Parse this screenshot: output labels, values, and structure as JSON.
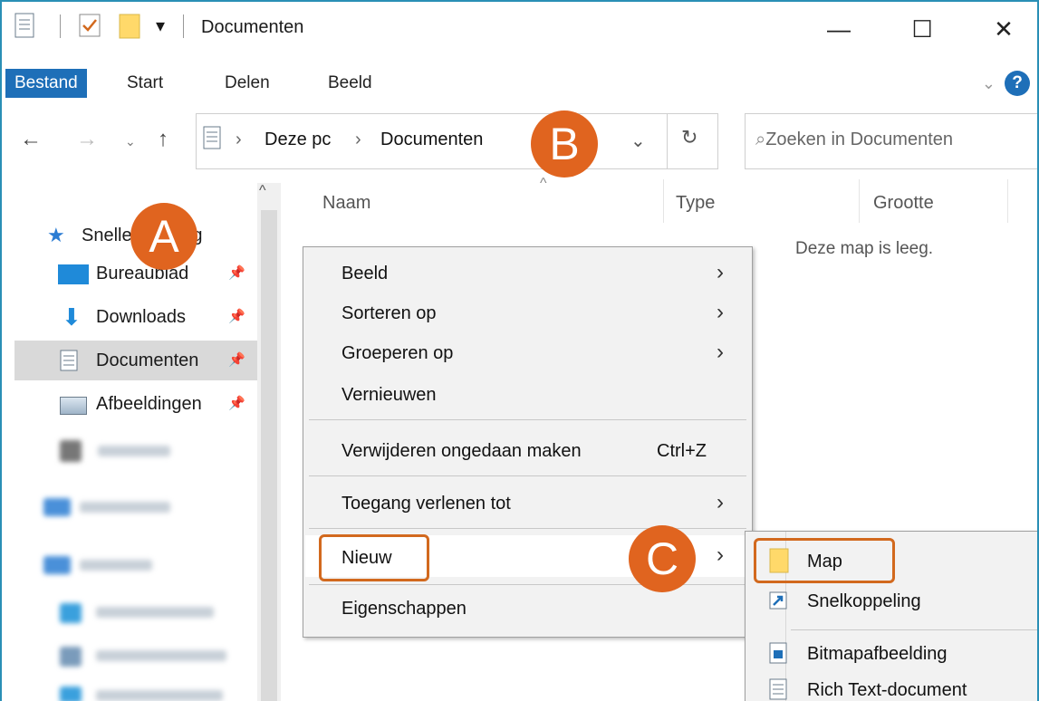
{
  "window": {
    "title": "Documenten"
  },
  "ribbon": {
    "tabs": [
      "Bestand",
      "Start",
      "Delen",
      "Beeld"
    ]
  },
  "address": {
    "crumb_root": "Deze pc",
    "crumb_current": "Documenten"
  },
  "search": {
    "placeholder": "Zoeken in Documenten"
  },
  "nav": {
    "quick_access": "Snelle toegang",
    "items": [
      "Bureaublad",
      "Downloads",
      "Documenten",
      "Afbeeldingen"
    ]
  },
  "columns": {
    "name": "Naam",
    "type": "Type",
    "size": "Grootte"
  },
  "content": {
    "empty": "Deze map is leeg."
  },
  "context_menu": {
    "items": [
      "Beeld",
      "Sorteren op",
      "Groeperen op",
      "Vernieuwen",
      "Verwijderen ongedaan maken",
      "Toegang verlenen tot",
      "Nieuw",
      "Eigenschappen"
    ],
    "undo_shortcut": "Ctrl+Z"
  },
  "submenu": {
    "items": [
      "Map",
      "Snelkoppeling",
      "Bitmapafbeelding",
      "Rich Text-document"
    ]
  },
  "markers": {
    "a": "A",
    "b": "B",
    "c": "C"
  },
  "colors": {
    "accent": "#1e6fb8",
    "marker": "#e0641f",
    "highlight": "#d2691e"
  }
}
